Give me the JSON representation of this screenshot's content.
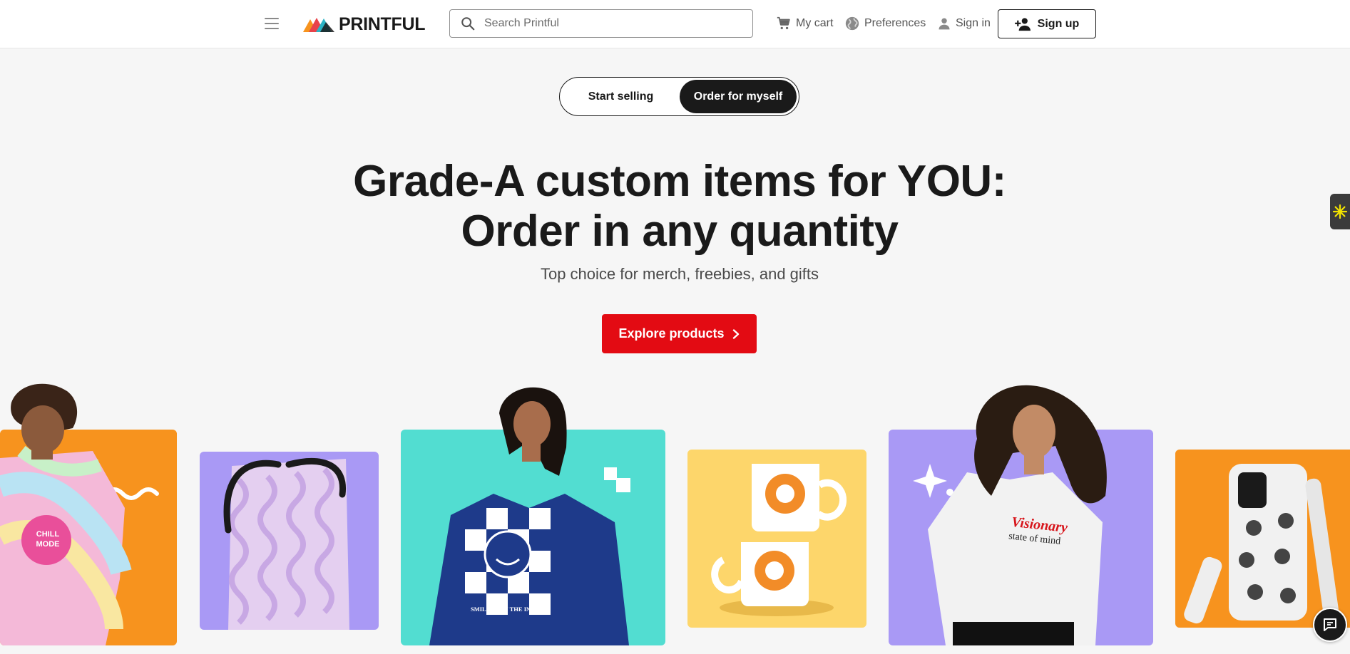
{
  "header": {
    "logo_text": "PRINTFUL",
    "search_placeholder": "Search Printful",
    "cart_label": "My cart",
    "preferences_label": "Preferences",
    "signin_label": "Sign in",
    "signup_label": "Sign up"
  },
  "toggle": {
    "option_1": "Start selling",
    "option_2": "Order for myself",
    "selected": "Order for myself"
  },
  "hero": {
    "title_line1": "Grade-A custom items for YOU:",
    "title_line2": "Order in any quantity",
    "subtitle": "Top choice for merch, freebies, and gifts",
    "cta_label": "Explore products"
  },
  "products": {
    "tile_1_print": "CHILL MODE",
    "tile_3_print": "SMILING ON THE INSIDE",
    "tile_5_print_1": "Visionary",
    "tile_5_print_2": "state of mind"
  },
  "colors": {
    "brand_red": "#e30b13",
    "dark": "#1a1a1a",
    "orange": "#f7931e",
    "lavender": "#a999f5",
    "teal": "#52ddd1",
    "yellow": "#fdd66b",
    "page_bg": "#f6f6f6"
  },
  "icons": [
    "hamburger-icon",
    "search-icon",
    "cart-icon",
    "globe-icon",
    "user-icon",
    "user-plus-icon",
    "chevron-right-icon",
    "sparkle-icon",
    "chat-icon"
  ]
}
